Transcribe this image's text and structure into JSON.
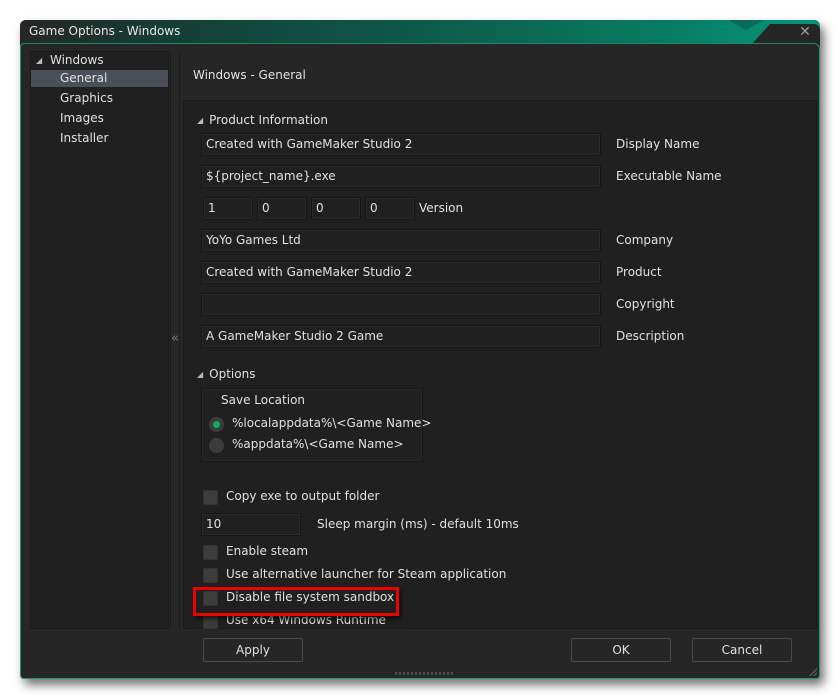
{
  "window": {
    "title": "Game Options - Windows",
    "close_icon": "close-x-icon",
    "accent_color": "#0e8a6a"
  },
  "tree": {
    "root": {
      "label": "Windows",
      "expanded": true,
      "icon": "caret-down-icon"
    },
    "items": [
      {
        "label": "General",
        "selected": true
      },
      {
        "label": "Graphics",
        "selected": false
      },
      {
        "label": "Images",
        "selected": false
      },
      {
        "label": "Installer",
        "selected": false
      }
    ],
    "collapse_icon": "double-chevron-left-icon"
  },
  "page": {
    "heading": "Windows - General"
  },
  "product_info": {
    "section_label": "Product Information",
    "display_name": {
      "value": "Created with GameMaker Studio 2",
      "label": "Display Name"
    },
    "executable_name": {
      "value": "${project_name}.exe",
      "label": "Executable Name"
    },
    "version": {
      "parts": [
        "1",
        "0",
        "0",
        "0"
      ],
      "label": "Version"
    },
    "company": {
      "value": "YoYo Games Ltd",
      "label": "Company"
    },
    "product": {
      "value": "Created with GameMaker Studio 2",
      "label": "Product"
    },
    "copyright": {
      "value": "",
      "label": "Copyright"
    },
    "description": {
      "value": "A GameMaker Studio 2 Game",
      "label": "Description"
    }
  },
  "options": {
    "section_label": "Options",
    "save_location": {
      "label": "Save Location",
      "choices": [
        {
          "label": "%localappdata%\\<Game Name>",
          "selected": true
        },
        {
          "label": "%appdata%\\<Game Name>",
          "selected": false
        }
      ],
      "selected_color": "#17a865"
    },
    "copy_exe": {
      "label": "Copy exe to output folder",
      "checked": false
    },
    "sleep_margin": {
      "value": "10",
      "label": "Sleep margin (ms) - default 10ms"
    },
    "enable_steam": {
      "label": "Enable steam",
      "checked": false
    },
    "alt_launcher": {
      "label": "Use alternative launcher for Steam application",
      "checked": false
    },
    "disable_sandbox": {
      "label": "Disable file system sandbox",
      "checked": false
    },
    "use_x64": {
      "label": "Use x64 Windows Runtime",
      "checked": false,
      "highlighted": true,
      "highlight_color": "#ee0000"
    }
  },
  "buttons": {
    "apply": "Apply",
    "ok": "OK",
    "cancel": "Cancel"
  }
}
